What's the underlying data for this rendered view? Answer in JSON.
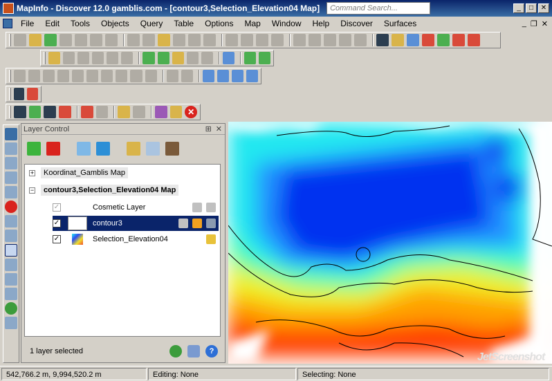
{
  "window": {
    "title": "MapInfo - Discover 12.0 gamblis.com - [contour3,Selection_Elevation04 Map]",
    "search_placeholder": "Command Search...",
    "buttons": {
      "minimize": "_",
      "maximize": "□",
      "close": "✕"
    }
  },
  "menubar": {
    "items": [
      "File",
      "Edit",
      "Tools",
      "Objects",
      "Query",
      "Table",
      "Options",
      "Map",
      "Window",
      "Help",
      "Discover",
      "Surfaces"
    ],
    "mdi": {
      "minimize": "_",
      "restore": "❐",
      "close": "✕"
    }
  },
  "layer_control": {
    "title": "Layer Control",
    "pin": "⊞",
    "close": "✕",
    "groups": [
      {
        "label": "Koordinat_Gamblis Map",
        "expander": "+"
      },
      {
        "label": "contour3,Selection_Elevation04 Map",
        "expander": "−"
      }
    ],
    "layers": [
      {
        "name": "Cosmetic Layer",
        "check": "✓"
      },
      {
        "name": "contour3",
        "check": "✓"
      },
      {
        "name": "Selection_Elevation04",
        "check": "✓"
      }
    ],
    "status": "1 layer selected",
    "help_label": "?"
  },
  "statusbar": {
    "coords": "542,766.2 m, 9,994,520.2 m",
    "editing": "Editing: None",
    "selecting": "Selecting: None"
  },
  "watermark": "JetScreenshot",
  "colors": {
    "title_bg": "#0a246a",
    "selected_row": "#0a246a",
    "heat_high": "#ff3c00",
    "heat_low": "#0010e0"
  }
}
